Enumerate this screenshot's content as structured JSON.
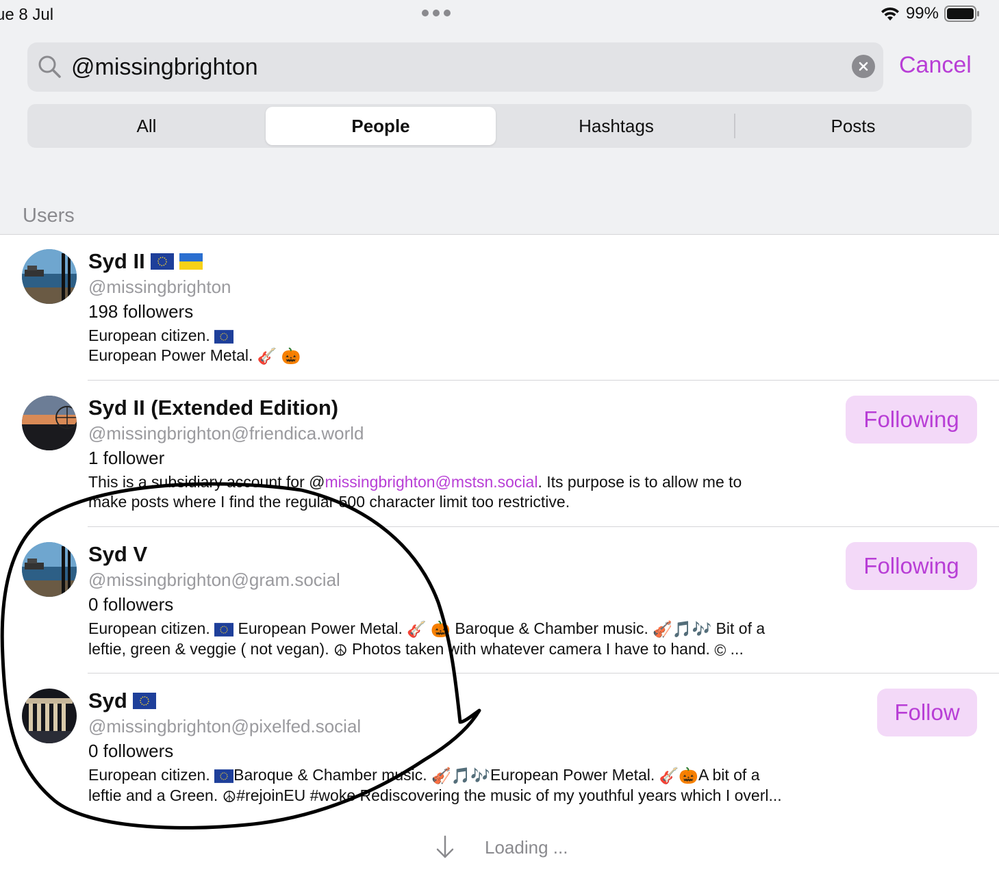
{
  "status_bar": {
    "date": "ue 8 Jul",
    "battery": "99%"
  },
  "search": {
    "value": "@missingbrighton",
    "cancel_label": "Cancel"
  },
  "tabs": [
    {
      "label": "All",
      "active": false
    },
    {
      "label": "People",
      "active": true
    },
    {
      "label": "Hashtags",
      "active": false
    },
    {
      "label": "Posts",
      "active": false
    }
  ],
  "section_header": "Users",
  "users": [
    {
      "name": "Syd II",
      "handle": "@missingbrighton",
      "followers": "198 followers",
      "bio_lines": [
        "European citizen.",
        "European Power Metal."
      ],
      "button": ""
    },
    {
      "name": "Syd II (Extended Edition)",
      "handle": "@missingbrighton@friendica.world",
      "followers": "1 follower",
      "bio_pre": "This is a subsidiary account for @",
      "bio_link": "missingbrighton@mstsn.social",
      "bio_post": ". Its purpose is to allow me to",
      "bio_line2": "make posts where I find the regular 500 character limit too restrictive.",
      "button": "Following"
    },
    {
      "name": "Syd V",
      "handle": "@missingbrighton@gram.social",
      "followers": "0 followers",
      "bio_l1a": "European citizen.",
      "bio_l1b": "European Power Metal.",
      "bio_l1c": "Baroque & Chamber music.",
      "bio_l1d": "Bit of a",
      "bio_l2a": "leftie, green & veggie ( not vegan).",
      "bio_l2b": "Photos taken with whatever camera I have to hand.",
      "bio_l2c": "...",
      "button": "Following"
    },
    {
      "name": "Syd",
      "handle": "@missingbrighton@pixelfed.social",
      "followers": "0 followers",
      "bio_l1a": "European citizen.",
      "bio_l1b": "Baroque & Chamber music.",
      "bio_l1c": "European Power Metal.",
      "bio_l1d": "A bit of a",
      "bio_l2a": "leftie and a Green.",
      "bio_l2b": "#rejoinEU #woke Rediscovering the music of my youthful years which I overl...",
      "button": "Follow"
    }
  ],
  "loading_text": "Loading ...",
  "colors": {
    "accent": "#b83ed6",
    "button_bg": "#f3d9f8",
    "secondary_text": "#8a8a8e"
  }
}
